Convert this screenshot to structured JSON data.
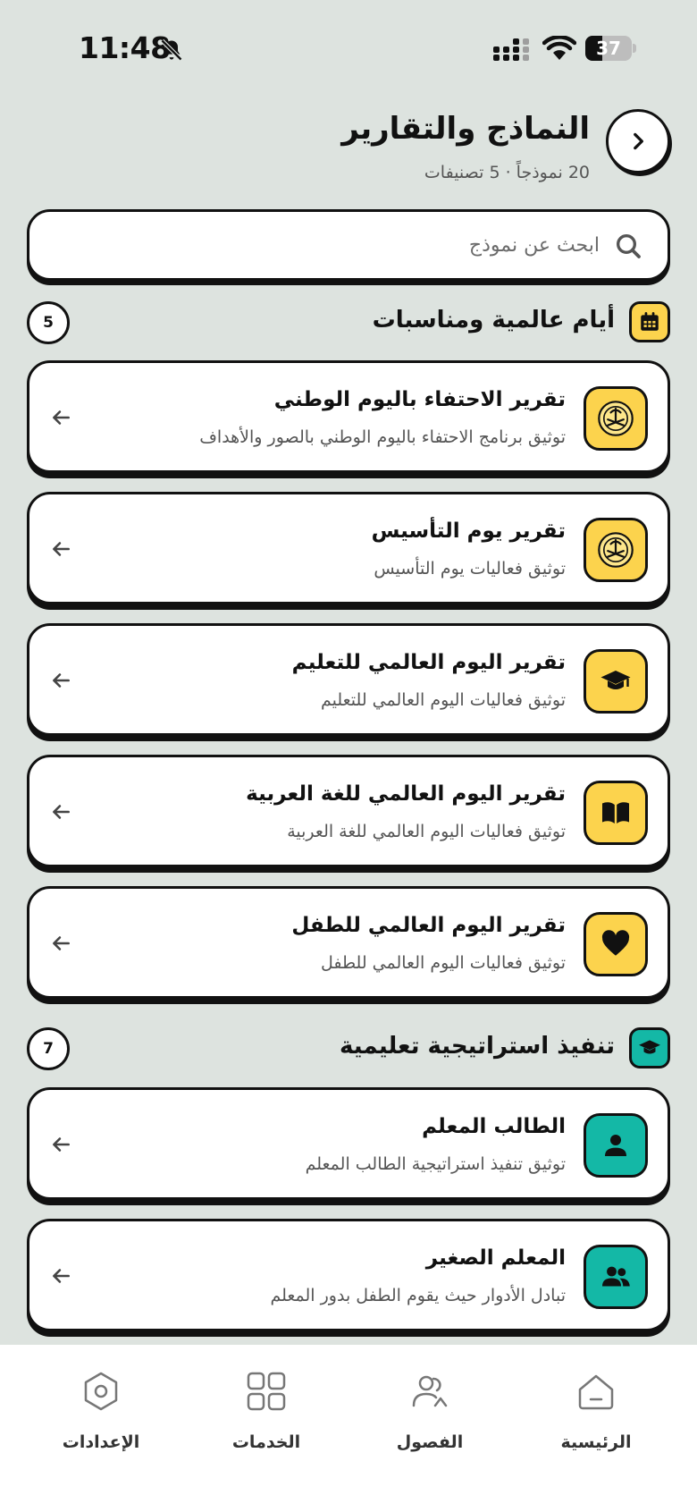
{
  "status_bar": {
    "time": "11:48",
    "battery": "37",
    "battery_level": 0.37
  },
  "header": {
    "title": "النماذج والتقارير",
    "subtitle": "20 نموذجاً · 5 تصنيفات"
  },
  "search": {
    "placeholder": "ابحث عن نموذج",
    "value": ""
  },
  "sections": [
    {
      "title": "أيام عالمية ومناسبات",
      "count": "5",
      "accent": "#fcd34d",
      "icon": "calendar-icon",
      "items": [
        {
          "title": "تقرير الاحتفاء باليوم الوطني",
          "description": "توثيق برنامج الاحتفاء باليوم الوطني بالصور والأهداف",
          "icon": "saudi-emblem-icon"
        },
        {
          "title": "تقرير يوم التأسيس",
          "description": "توثيق فعاليات يوم التأسيس",
          "icon": "saudi-emblem-icon"
        },
        {
          "title": "تقرير اليوم العالمي للتعليم",
          "description": "توثيق فعاليات اليوم العالمي للتعليم",
          "icon": "graduation-cap-icon"
        },
        {
          "title": "تقرير اليوم العالمي للغة العربية",
          "description": "توثيق فعاليات اليوم العالمي للغة العربية",
          "icon": "book-icon"
        },
        {
          "title": "تقرير اليوم العالمي للطفل",
          "description": "توثيق فعاليات اليوم العالمي للطفل",
          "icon": "heart-icon"
        }
      ]
    },
    {
      "title": "تنفيذ استراتيجية تعليمية",
      "count": "7",
      "accent": "#14b8a6",
      "icon": "graduation-cap-icon",
      "items": [
        {
          "title": "الطالب المعلم",
          "description": "توثيق تنفيذ استراتيجية الطالب المعلم",
          "icon": "person-icon"
        },
        {
          "title": "المعلم الصغير",
          "description": "تبادل الأدوار حيث يقوم الطفل بدور المعلم",
          "icon": "group-icon"
        }
      ]
    }
  ],
  "bottom_nav": [
    {
      "label": "الرئيسية",
      "icon": "home-icon"
    },
    {
      "label": "الفصول",
      "icon": "classes-icon"
    },
    {
      "label": "الخدمات",
      "icon": "services-grid-icon"
    },
    {
      "label": "الإعدادات",
      "icon": "settings-icon"
    }
  ]
}
